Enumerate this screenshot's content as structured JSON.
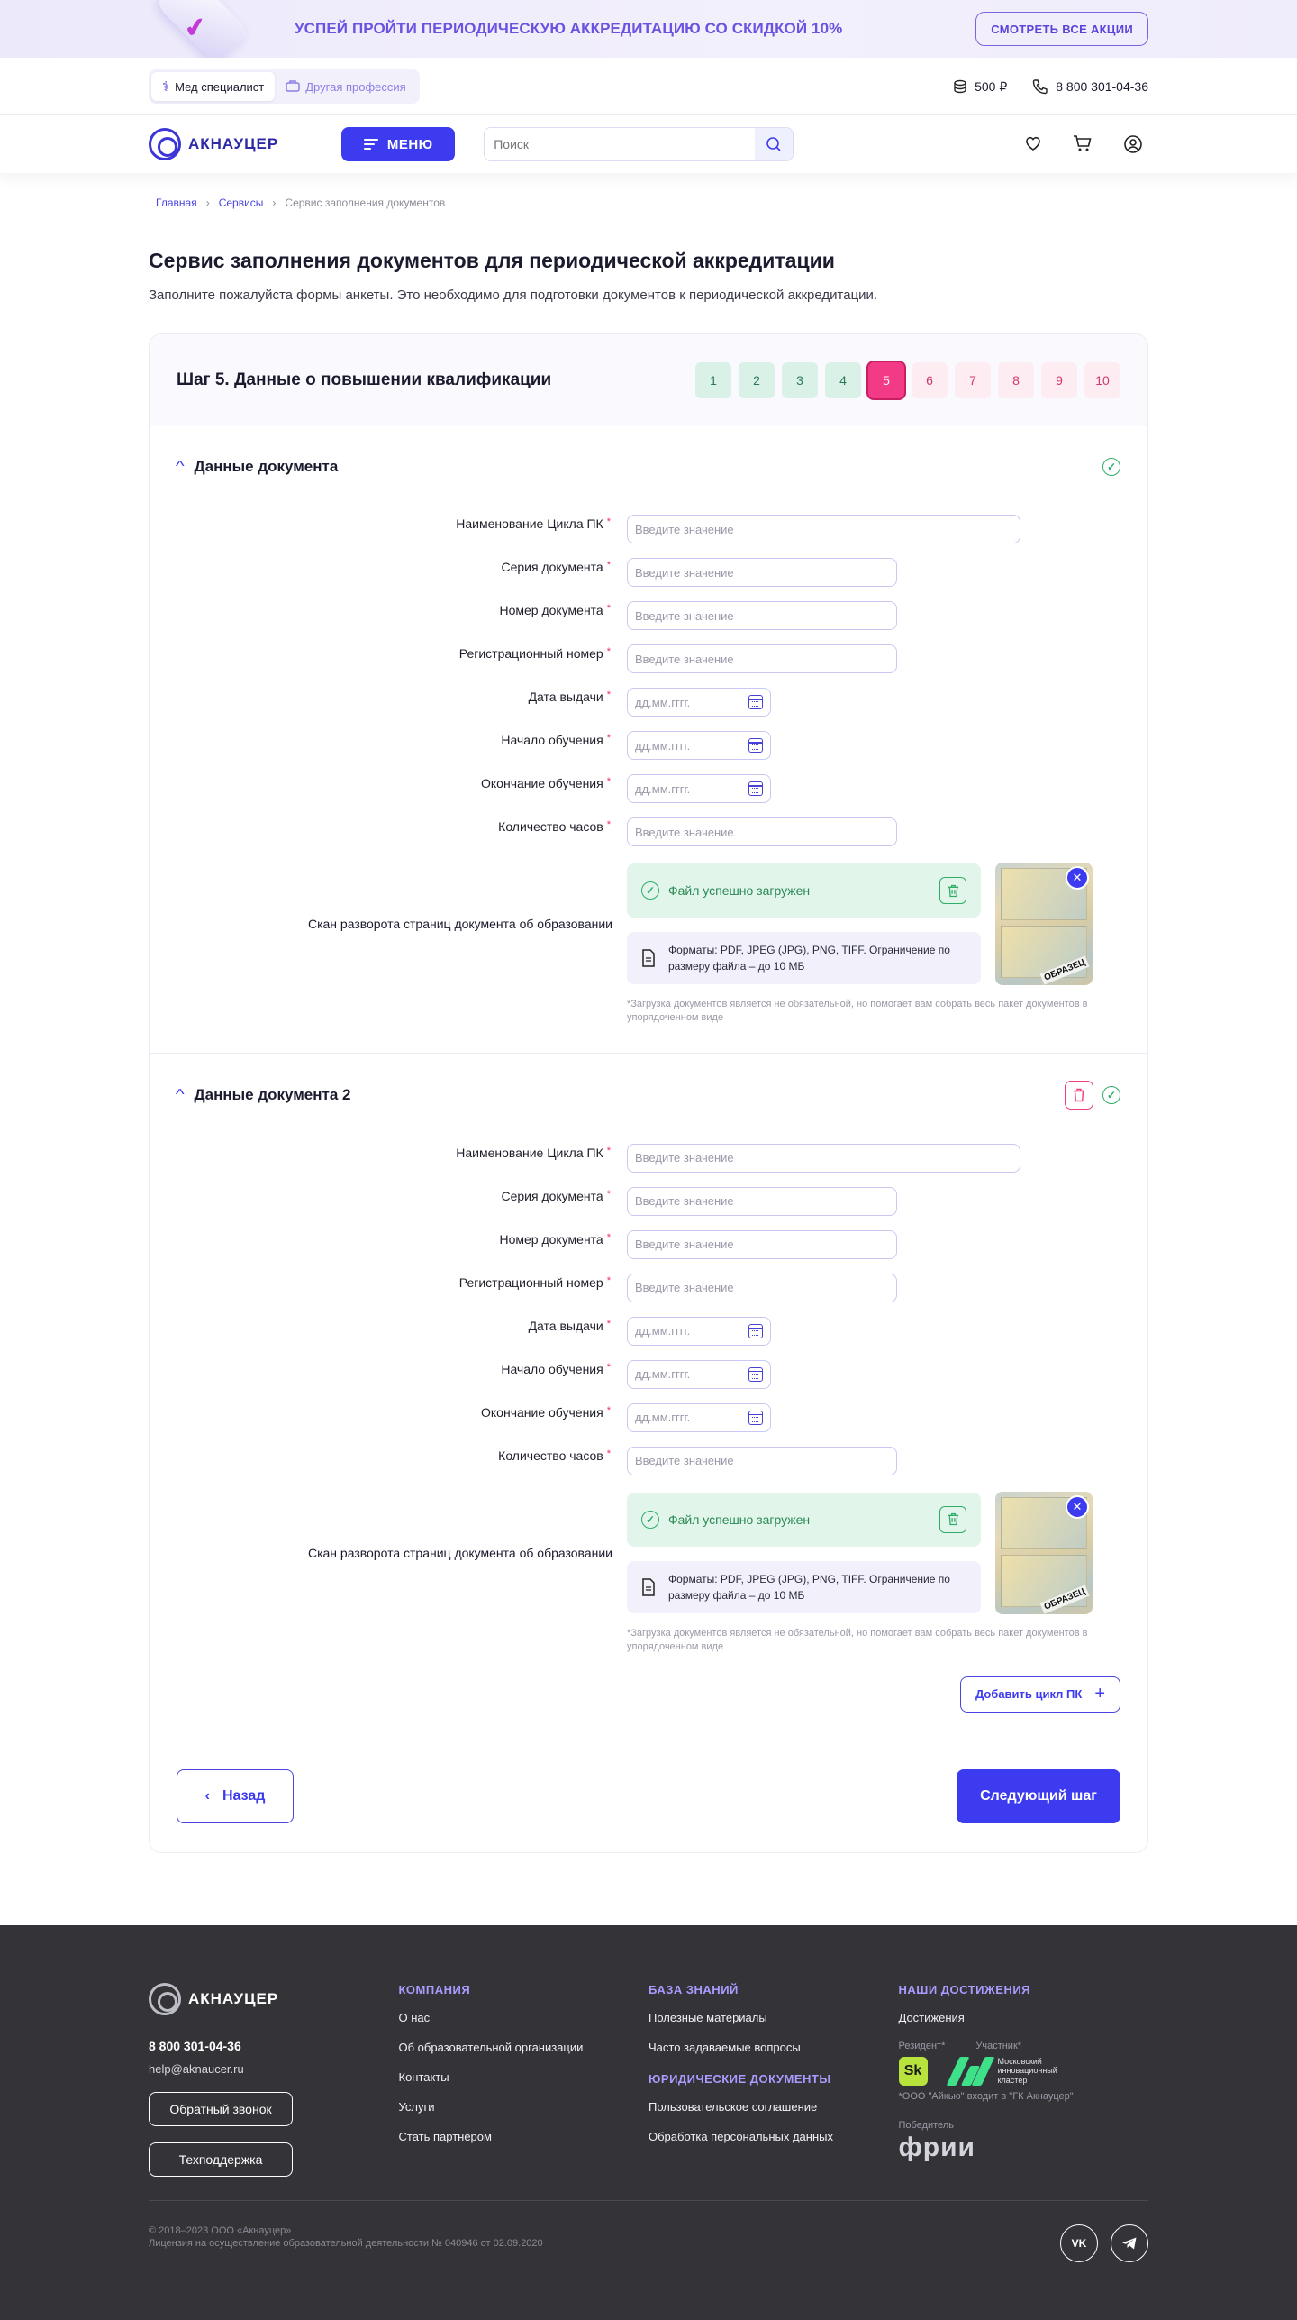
{
  "promo": {
    "text": "УСПЕЙ ПРОЙТИ ПЕРИОДИЧЕСКУЮ АККРЕДИТАЦИЮ СО СКИДКОЙ 10%",
    "button": "СМОТРЕТЬ ВСЕ АКЦИИ"
  },
  "roles": {
    "active": "Мед специалист",
    "inactive": "Другая профессия"
  },
  "topbar": {
    "balance": "500 ₽",
    "phone": "8 800 301-04-36"
  },
  "header": {
    "logo": "АКНАУЦЕР",
    "menu": "МЕНЮ",
    "search_placeholder": "Поиск"
  },
  "breadcrumbs": {
    "home": "Главная",
    "services": "Сервисы",
    "current": "Сервис заполнения документов"
  },
  "page": {
    "title": "Сервис заполнения документов для периодической аккредитации",
    "lead": "Заполните пожалуйста формы анкеты. Это необходимо для подготовки документов к периодической аккредитации."
  },
  "step": {
    "title": "Шаг 5. Данные о повышении квалификации",
    "steps": [
      "1",
      "2",
      "3",
      "4",
      "5",
      "6",
      "7",
      "8",
      "9",
      "10"
    ],
    "current": 5
  },
  "fields": {
    "cycle": "Наименование Цикла ПК",
    "series": "Серия документа",
    "number": "Номер документа",
    "reg": "Регистрационный номер",
    "issue": "Дата выдачи",
    "start": "Начало обучения",
    "end": "Окончание обучения",
    "hours": "Количество часов",
    "scan": "Скан разворота страниц документа об образовании",
    "placeholder": "Введите значение",
    "date_placeholder": "дд.мм.гггг.",
    "required": "*"
  },
  "upload": {
    "success": "Файл успешно загружен",
    "formats": "Форматы: PDF, JPEG (JPG), PNG, TIFF. Ограничение по размеру файла – до 10 МБ",
    "stamp": "ОБРАЗЕЦ",
    "note": "*Загрузка документов является не обязательной, но помогает вам собрать весь пакет документов в упорядоченном виде"
  },
  "sections": [
    {
      "title": "Данные документа"
    },
    {
      "title": "Данные документа 2"
    }
  ],
  "actions": {
    "add_cycle": "Добавить цикл ПК",
    "back": "Назад",
    "next": "Следующий шаг"
  },
  "footer": {
    "logo": "АКНАУЦЕР",
    "phone": "8 800 301-04-36",
    "email": "help@aknaucer.ru",
    "callback": "Обратный звонок",
    "support": "Техподдержка",
    "company_title": "КОМПАНИЯ",
    "company": [
      "О нас",
      "Об образовательной организации",
      "Контакты",
      "Услуги",
      "Стать партнёром"
    ],
    "kb_title": "БАЗА ЗНАНИЙ",
    "kb": [
      "Полезные материалы",
      "Часто задаваемые вопросы"
    ],
    "legal_title": "ЮРИДИЧЕСКИЕ ДОКУМЕНТЫ",
    "legal_docs": [
      "Пользовательское соглашение",
      "Обработка персональных данных"
    ],
    "ach_title": "НАШИ ДОСТИЖЕНИЯ",
    "ach_link": "Достижения",
    "resident": "Резидент*",
    "participant": "Участник*",
    "mik": "Московский инновационный кластер",
    "aykyu": "*ООО \"Айкью\" входит в \"ГК Акнауцер\"",
    "winner": "Победитель",
    "frii": "фрии",
    "copyright": "© 2018–2023 ООО «Акнауцер»",
    "license": "Лицензия на осуществление образовательной деятельности  № 040946 от 02.09.2020",
    "vk": "VK",
    "tg": "TG"
  }
}
